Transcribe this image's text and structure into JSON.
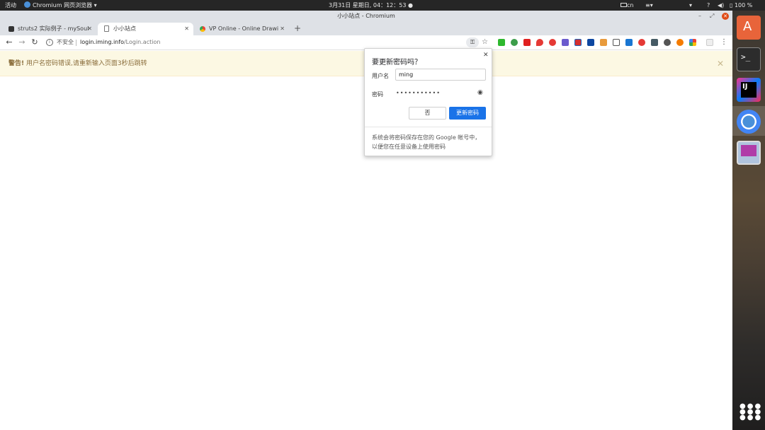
{
  "topbar": {
    "activities": "活动",
    "app_name": "Chromium 网页浏览器",
    "clock": "3月31日 星期日, 04：12：53",
    "input_method": "cn",
    "battery": "100 %"
  },
  "window": {
    "title": "小小站点 - Chromium"
  },
  "tabs": [
    {
      "label": "struts2 实际例子 - mySoul"
    },
    {
      "label": "小小站点"
    },
    {
      "label": "VP Online - Online Drawi"
    }
  ],
  "toolbar": {
    "security_label": "不安全",
    "url_host": "login.iming.info",
    "url_path": "/Login.action"
  },
  "alert": {
    "prefix": "警告!",
    "message": "用户名密码错误,请重新输入页面3秒后跳转"
  },
  "bubble": {
    "title": "要更新密码吗？",
    "username_label": "用户名",
    "username_value": "ming",
    "password_label": "密码",
    "password_mask": "•••••••••••",
    "no_label": "否",
    "update_label": "更新密码",
    "footer_line1": "系统会将密码保存在您的 Google 帐号中，",
    "footer_line2": "以便您在任意设备上使用密码"
  },
  "colors": {
    "accent": "#1a73e8",
    "alert_bg": "#fcf8e3",
    "alert_text": "#8a6d3b"
  }
}
